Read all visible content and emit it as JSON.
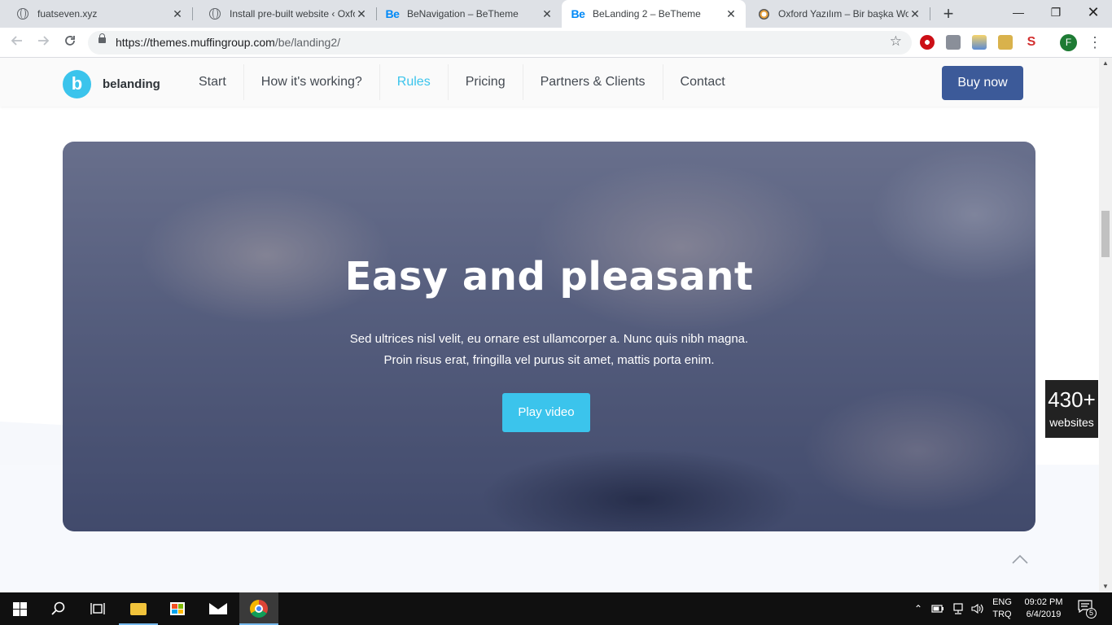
{
  "browser": {
    "tabs": [
      {
        "title": "fuatseven.xyz",
        "favicon": "globe-icon",
        "active": false
      },
      {
        "title": "Install pre-built website ‹ Oxford",
        "favicon": "globe-icon",
        "active": false
      },
      {
        "title": "BeNavigation – BeTheme",
        "favicon": "be-icon",
        "active": false
      },
      {
        "title": "BeLanding 2 – BeTheme",
        "favicon": "be-icon",
        "active": true
      },
      {
        "title": "Oxford Yazılım – Bir başka WordPress",
        "favicon": "wordpress-icon",
        "active": false
      }
    ],
    "favicon_text": "Be",
    "close_glyph": "✕",
    "new_tab_glyph": "+",
    "window_controls": {
      "minimize": "—",
      "restore": "❐",
      "close": "✕"
    },
    "url_host": "https://themes.muffingroup.com",
    "url_path": "/be/landing2/",
    "profile_initial": "F"
  },
  "site": {
    "logo_glyph": "b",
    "logo_text": "belanding",
    "nav": [
      {
        "label": "Start",
        "active": false
      },
      {
        "label": "How it's working?",
        "active": false
      },
      {
        "label": "Rules",
        "active": true
      },
      {
        "label": "Pricing",
        "active": false
      },
      {
        "label": "Partners & Clients",
        "active": false
      },
      {
        "label": "Contact",
        "active": false
      }
    ],
    "buy_button": "Buy now",
    "accent_color": "#3bc4ec",
    "buy_color": "#3c5a99"
  },
  "hero": {
    "title": "Easy and pleasant",
    "text_line1": "Sed ultrices nisl velit, eu ornare est ullamcorper a. Nunc quis nibh magna.",
    "text_line2": "Proin risus erat, fringilla vel purus sit amet, mattis porta enim.",
    "button": "Play video"
  },
  "counter": {
    "number": "430+",
    "label": "websites"
  },
  "taskbar": {
    "language_line1": "ENG",
    "language_line2": "TRQ",
    "time": "09:02 PM",
    "date": "6/4/2019",
    "notification_count": "5"
  }
}
